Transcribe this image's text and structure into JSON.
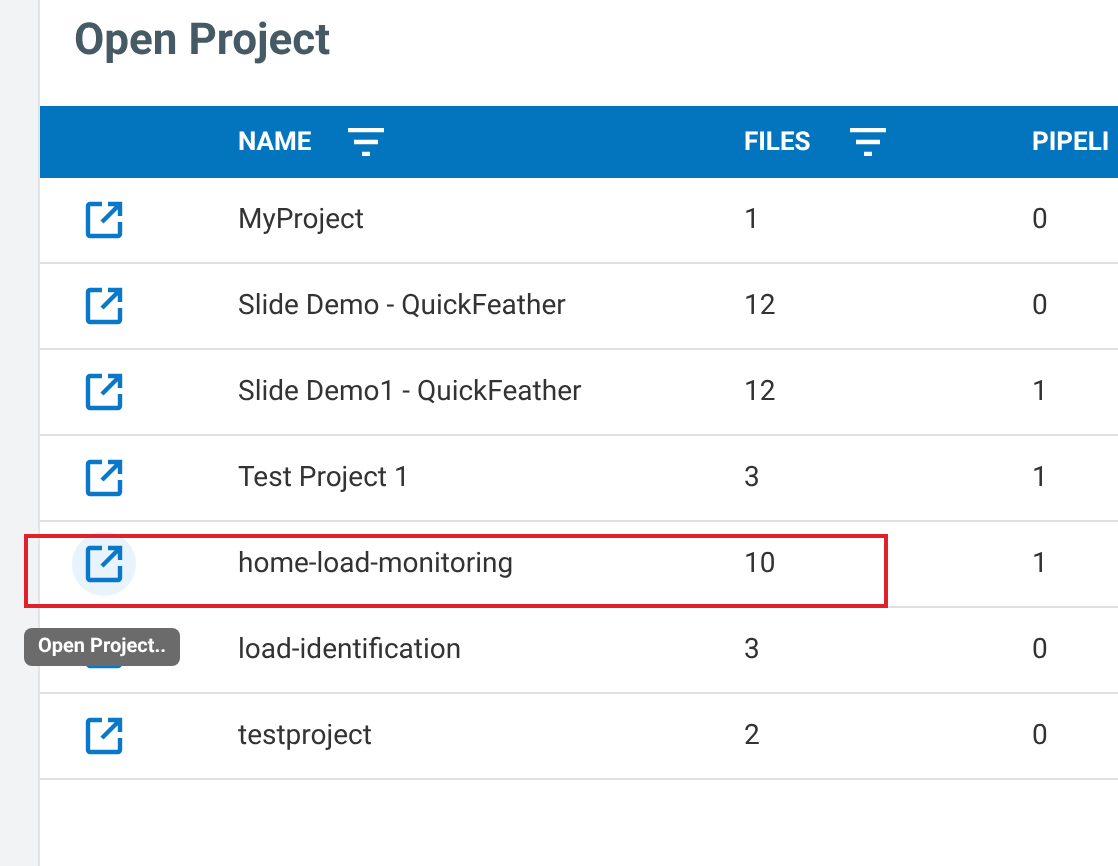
{
  "title": "Open Project",
  "table": {
    "columns": [
      {
        "label": "NAME",
        "filter": true
      },
      {
        "label": "FILES",
        "filter": true
      },
      {
        "label": "PIPELI",
        "filter": false
      }
    ],
    "rows": [
      {
        "name": "MyProject",
        "files": "1",
        "pipelines": "0",
        "hovered": false,
        "highlighted": false
      },
      {
        "name": "Slide Demo - QuickFeather",
        "files": "12",
        "pipelines": "0",
        "hovered": false,
        "highlighted": false
      },
      {
        "name": "Slide Demo1 - QuickFeather",
        "files": "12",
        "pipelines": "1",
        "hovered": false,
        "highlighted": false
      },
      {
        "name": "Test Project 1",
        "files": "3",
        "pipelines": "1",
        "hovered": false,
        "highlighted": false
      },
      {
        "name": "home-load-monitoring",
        "files": "10",
        "pipelines": "1",
        "hovered": true,
        "highlighted": true
      },
      {
        "name": "load-identification",
        "files": "3",
        "pipelines": "0",
        "hovered": false,
        "highlighted": false
      },
      {
        "name": "testproject",
        "files": "2",
        "pipelines": "0",
        "hovered": false,
        "highlighted": false
      }
    ]
  },
  "tooltip": {
    "text": "Open Project.."
  }
}
